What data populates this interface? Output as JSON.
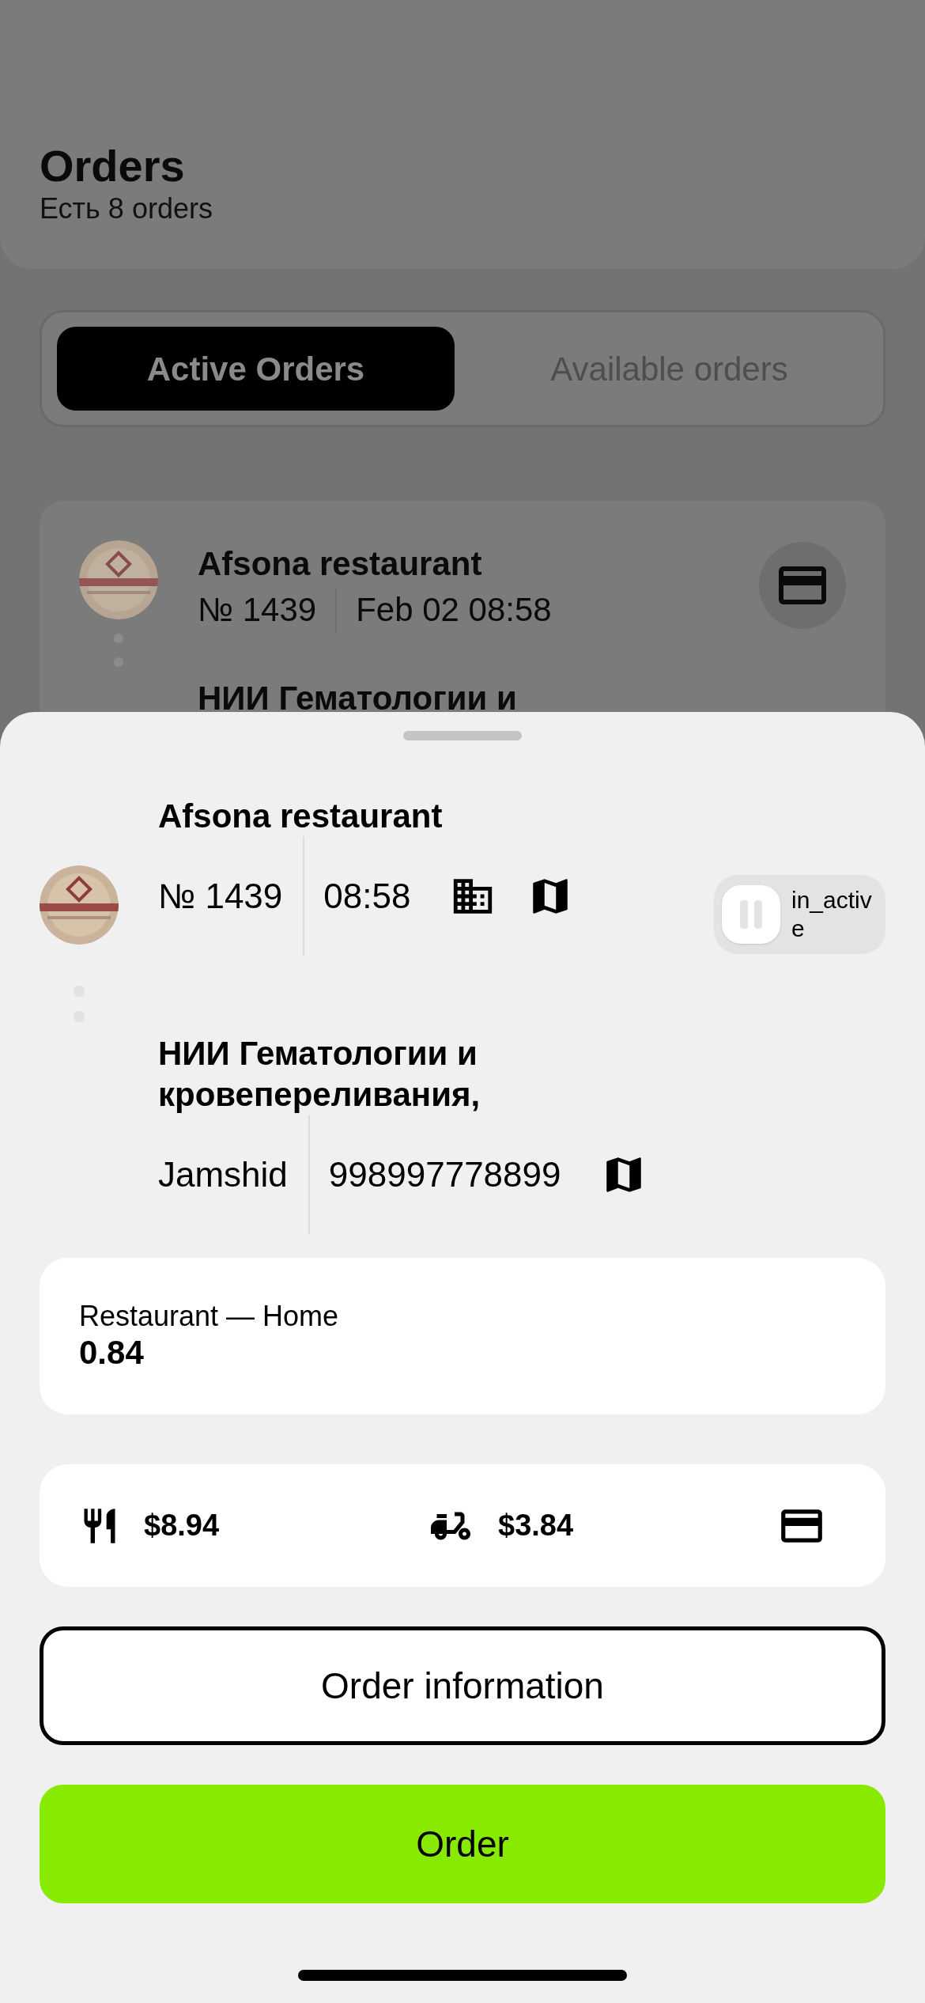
{
  "header": {
    "title": "Orders",
    "subtitle": "Есть 8 orders"
  },
  "tabs": [
    {
      "label": "Active Orders",
      "selected": true
    },
    {
      "label": "Available orders",
      "selected": false
    }
  ],
  "background_order": {
    "restaurant": "Afsona restaurant",
    "number": "№ 1439",
    "datetime": "Feb 02 08:58",
    "destination": "НИИ Гематологии и"
  },
  "sheet": {
    "pickup": {
      "name": "Afsona restaurant",
      "number": "№ 1439",
      "time": "08:58"
    },
    "status_toggle": {
      "label": "in_active",
      "on": false
    },
    "dropoff": {
      "name": "НИИ Гематологии и кровепереливания,",
      "customer": "Jamshid",
      "phone": "998997778899"
    },
    "distance": {
      "label": "Restaurant — Home",
      "value": "0.84"
    },
    "prices": [
      {
        "kind": "food",
        "amount": "$8.94"
      },
      {
        "kind": "delivery",
        "amount": "$3.84"
      }
    ],
    "buttons": [
      {
        "kind": "outline",
        "label": "Order information"
      },
      {
        "kind": "primary",
        "label": "Order"
      }
    ]
  }
}
